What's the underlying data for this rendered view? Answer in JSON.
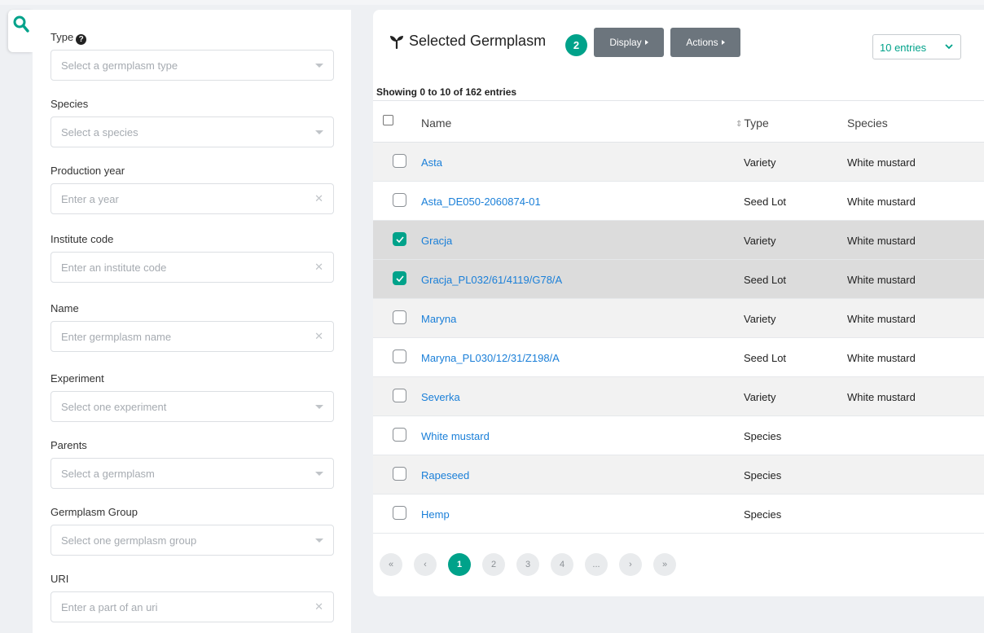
{
  "colors": {
    "accent": "#00a28a",
    "link": "#1a7fd8",
    "button_grey": "#6c757d"
  },
  "filters": [
    {
      "label": "Type",
      "placeholder": "Select a germplasm type",
      "kind": "select",
      "help": true
    },
    {
      "label": "Species",
      "placeholder": "Select a species",
      "kind": "select"
    },
    {
      "label": "Production year",
      "placeholder": "Enter a year",
      "kind": "text"
    },
    {
      "label": "Institute code",
      "placeholder": "Enter an institute code",
      "kind": "text"
    },
    {
      "label": "Name",
      "placeholder": "Enter germplasm name",
      "kind": "text"
    },
    {
      "label": "Experiment",
      "placeholder": "Select one experiment",
      "kind": "select"
    },
    {
      "label": "Parents",
      "placeholder": "Select a germplasm",
      "kind": "select"
    },
    {
      "label": "Germplasm Group",
      "placeholder": "Select one germplasm group",
      "kind": "select"
    },
    {
      "label": "URI",
      "placeholder": "Enter a part of an uri",
      "kind": "text"
    }
  ],
  "header": {
    "title": "Selected Germplasm",
    "selected_count": "2",
    "display_label": "Display",
    "actions_label": "Actions",
    "entries_label": "10 entries"
  },
  "table": {
    "showing": "Showing 0 to 10 of 162 entries",
    "columns": [
      "Name",
      "Type",
      "Species"
    ],
    "rows": [
      {
        "name": "Asta",
        "type": "Variety",
        "species": "White mustard",
        "checked": false
      },
      {
        "name": "Asta_DE050-2060874-01",
        "type": "Seed Lot",
        "species": "White mustard",
        "checked": false
      },
      {
        "name": "Gracja",
        "type": "Variety",
        "species": "White mustard",
        "checked": true
      },
      {
        "name": "Gracja_PL032/61/4119/G78/A",
        "type": "Seed Lot",
        "species": "White mustard",
        "checked": true
      },
      {
        "name": "Maryna",
        "type": "Variety",
        "species": "White mustard",
        "checked": false
      },
      {
        "name": "Maryna_PL030/12/31/Z198/A",
        "type": "Seed Lot",
        "species": "White mustard",
        "checked": false
      },
      {
        "name": "Severka",
        "type": "Variety",
        "species": "White mustard",
        "checked": false
      },
      {
        "name": "White mustard",
        "type": "Species",
        "species": "",
        "checked": false
      },
      {
        "name": "Rapeseed",
        "type": "Species",
        "species": "",
        "checked": false
      },
      {
        "name": "Hemp",
        "type": "Species",
        "species": "",
        "checked": false
      }
    ]
  },
  "pagination": {
    "first": "«",
    "prev": "‹",
    "pages": [
      "1",
      "2",
      "3",
      "4"
    ],
    "ellipsis": "...",
    "next": "›",
    "last": "»",
    "current": "1"
  }
}
